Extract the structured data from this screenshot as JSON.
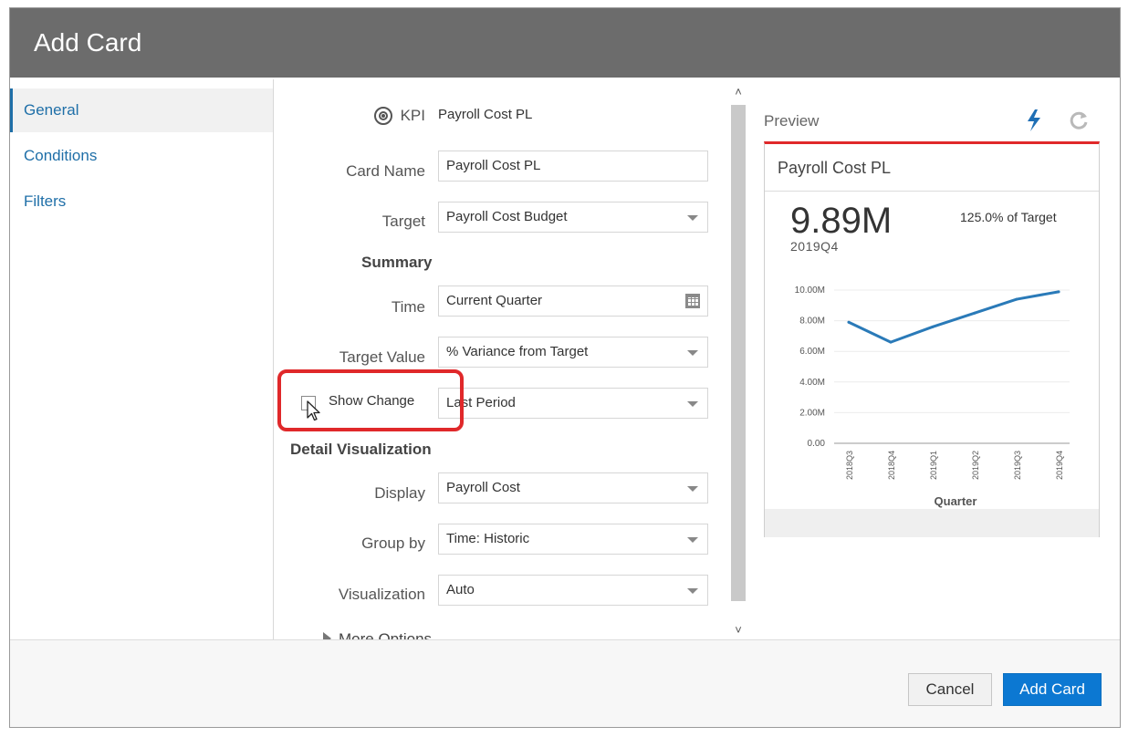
{
  "dialog": {
    "title": "Add Card"
  },
  "nav": {
    "items": [
      {
        "label": "General",
        "active": true
      },
      {
        "label": "Conditions",
        "active": false
      },
      {
        "label": "Filters",
        "active": false
      }
    ]
  },
  "form": {
    "kpi_label": "KPI",
    "kpi_value": "Payroll Cost PL",
    "card_name_label": "Card Name",
    "card_name_value": "Payroll Cost PL",
    "target_label": "Target",
    "target_value": "Payroll Cost Budget",
    "summary_heading": "Summary",
    "time_label": "Time",
    "time_value": "Current Quarter",
    "target_value_label": "Target Value",
    "target_value_value": "% Variance from Target",
    "show_change_label": "Show Change",
    "show_change_checked": false,
    "show_change_value": "Last Period",
    "detail_heading": "Detail Visualization",
    "display_label": "Display",
    "display_value": "Payroll Cost",
    "group_by_label": "Group by",
    "group_by_value": "Time: Historic",
    "visualization_label": "Visualization",
    "visualization_value": "Auto",
    "more_options_label": "More Options"
  },
  "preview": {
    "label": "Preview",
    "card_title": "Payroll Cost PL",
    "value": "9.89M",
    "period": "2019Q4",
    "target_pct": "125.0% of Target",
    "line_color": "#2a7ab8",
    "accent_color": "#e0282a"
  },
  "chart_data": {
    "type": "line",
    "x": [
      "2018Q3",
      "2018Q4",
      "2019Q1",
      "2019Q2",
      "2019Q3",
      "2019Q4"
    ],
    "values": [
      7.9,
      6.6,
      7.6,
      8.5,
      9.4,
      9.89
    ],
    "y_ticks": [
      "0.00",
      "2.00M",
      "4.00M",
      "6.00M",
      "8.00M",
      "10.00M"
    ],
    "ylim": [
      0,
      10
    ],
    "xlabel": "Quarter",
    "grid": true
  },
  "footer": {
    "cancel_label": "Cancel",
    "add_label": "Add Card"
  }
}
